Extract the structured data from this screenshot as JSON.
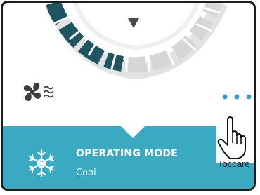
{
  "operating_mode": {
    "title": "OPERATING MODE",
    "value": "Cool"
  },
  "cursor_label": "Toccare",
  "icons": {
    "fan": "fan-speed-icon",
    "more": "more-options-icon",
    "mode": "snowflake-icon",
    "cursor": "hand-pointer-icon",
    "dial": "temperature-dial"
  },
  "colors": {
    "accent": "#3aa9c2",
    "dial_active": "#1e5560",
    "dial_inactive": "#dadada",
    "dots": "#2f9fd0"
  }
}
